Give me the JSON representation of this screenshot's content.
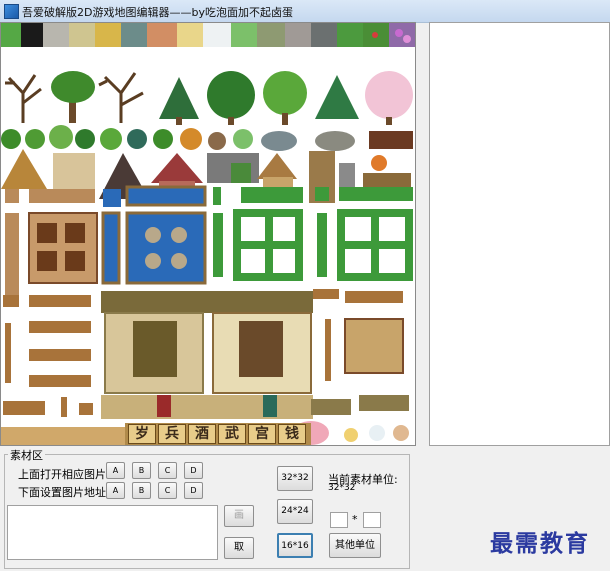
{
  "window": {
    "title": "吾爱破解版2D游戏地图编辑器——by吃泡面加不起卤蛋"
  },
  "tileset": {
    "signs": [
      "岁",
      "兵",
      "酒",
      "武",
      "宫",
      "钱"
    ]
  },
  "material": {
    "group_label": "素材区",
    "open_label": "上面打开相应图片",
    "set_label": "下面设置图片地址",
    "open_buttons": [
      "A",
      "B",
      "C",
      "D"
    ],
    "set_buttons": [
      "A",
      "B",
      "C",
      "D"
    ],
    "draw_label": "画",
    "take_label": "取"
  },
  "sizes": {
    "s32_label": "32*32",
    "s24_label": "24*24",
    "s16_label": "16*16",
    "selected": "16*16",
    "current_unit_label": "当前素材单位:",
    "current_unit_value": "32*32",
    "star": "*",
    "other_label": "其他单位"
  },
  "watermark": "最需教育",
  "colors": {
    "selection_border": "#3c7fb1",
    "watermark": "#2b3aa0"
  }
}
